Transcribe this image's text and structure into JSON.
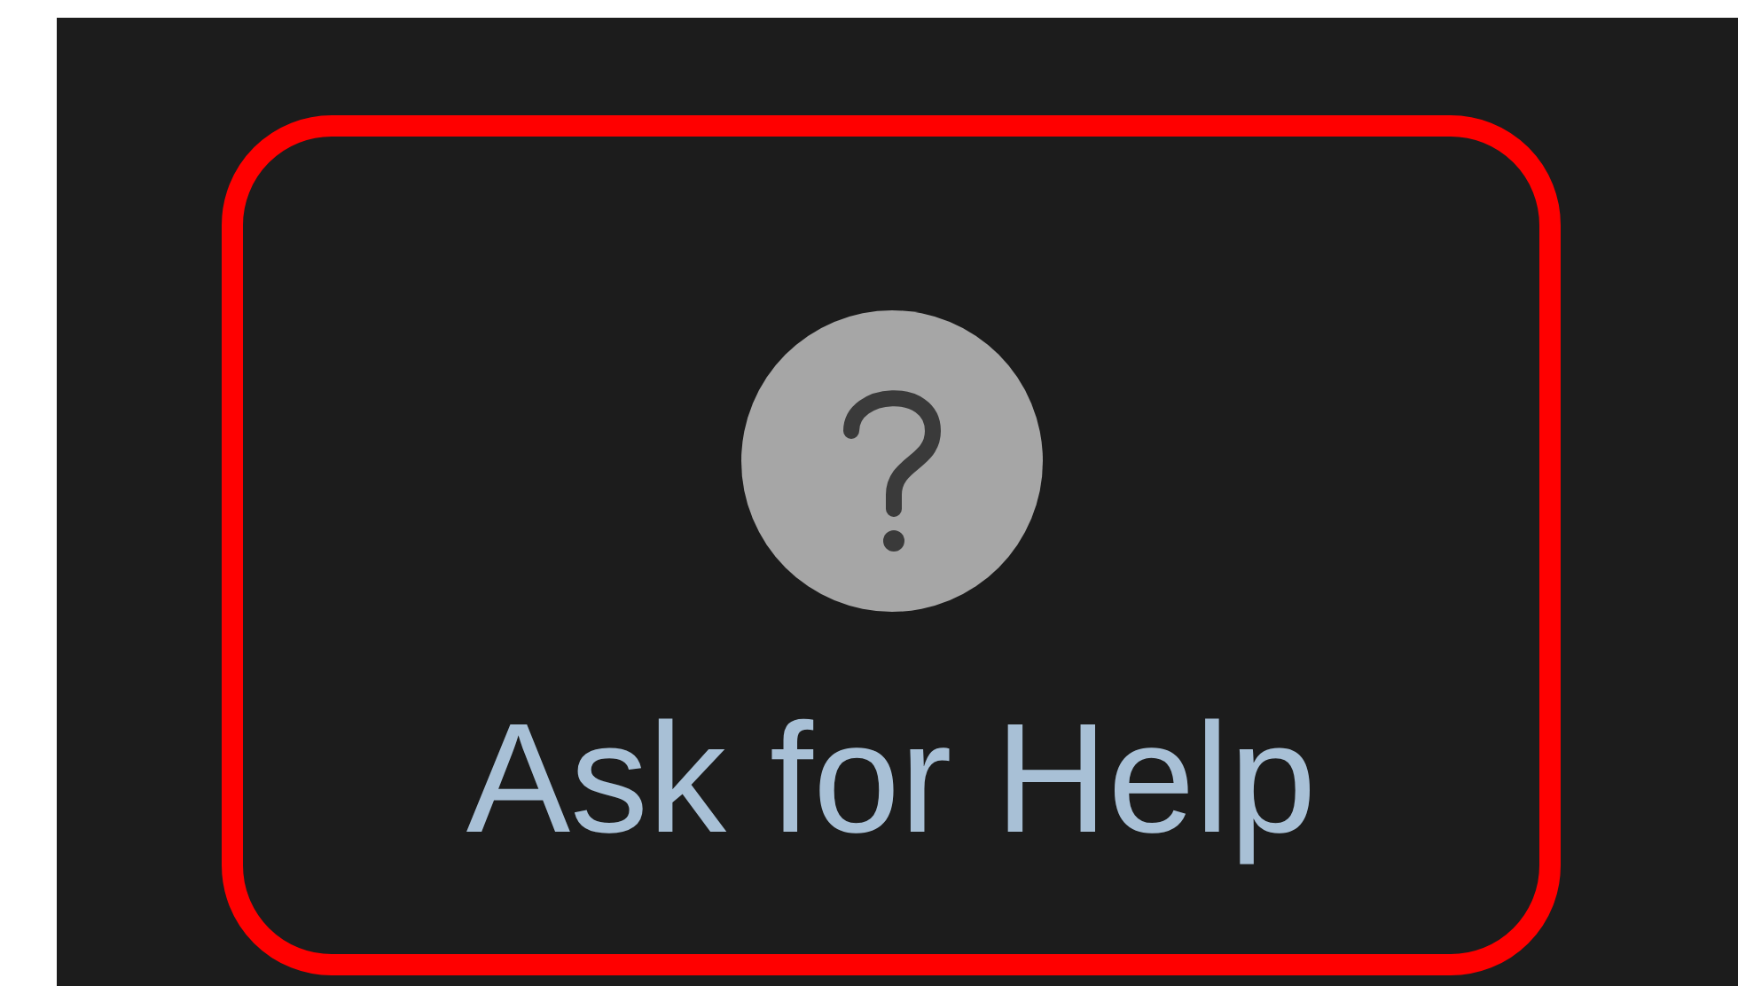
{
  "button": {
    "label": "Ask for Help",
    "highlighted": true
  }
}
